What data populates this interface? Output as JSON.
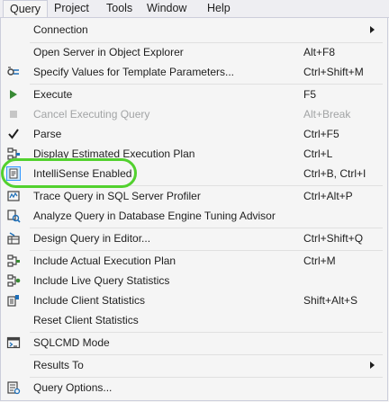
{
  "menubar": {
    "items": [
      {
        "label": "Query"
      },
      {
        "label": "Project"
      },
      {
        "label": "Tools"
      },
      {
        "label": "Window"
      },
      {
        "label": "Help"
      }
    ]
  },
  "menu": {
    "items": [
      {
        "label": "Connection",
        "shortcut": "",
        "icon": "none",
        "submenu": true
      },
      {
        "label": "Open Server in Object Explorer",
        "shortcut": "Alt+F8",
        "icon": "none"
      },
      {
        "label": "Specify Values for Template Parameters...",
        "shortcut": "Ctrl+Shift+M",
        "icon": "template-parameters-icon"
      },
      {
        "label": "Execute",
        "shortcut": "F5",
        "icon": "play-icon"
      },
      {
        "label": "Cancel Executing Query",
        "shortcut": "Alt+Break",
        "icon": "stop-icon",
        "disabled": true
      },
      {
        "label": "Parse",
        "shortcut": "Ctrl+F5",
        "icon": "checkmark-icon"
      },
      {
        "label": "Display Estimated Execution Plan",
        "shortcut": "Ctrl+L",
        "icon": "estimated-plan-icon"
      },
      {
        "label": "IntelliSense Enabled",
        "shortcut": "Ctrl+B, Ctrl+I",
        "icon": "intellisense-icon",
        "checked": true
      },
      {
        "label": "Trace Query in SQL Server Profiler",
        "shortcut": "Ctrl+Alt+P",
        "icon": "profiler-icon"
      },
      {
        "label": "Analyze Query in Database Engine Tuning Advisor",
        "shortcut": "",
        "icon": "tuning-advisor-icon"
      },
      {
        "label": "Design Query in Editor...",
        "shortcut": "Ctrl+Shift+Q",
        "icon": "design-query-icon"
      },
      {
        "label": "Include Actual Execution Plan",
        "shortcut": "Ctrl+M",
        "icon": "actual-plan-icon"
      },
      {
        "label": "Include Live Query Statistics",
        "shortcut": "",
        "icon": "live-stats-icon"
      },
      {
        "label": "Include Client Statistics",
        "shortcut": "Shift+Alt+S",
        "icon": "client-stats-icon"
      },
      {
        "label": "Reset Client Statistics",
        "shortcut": "",
        "icon": "none"
      },
      {
        "label": "SQLCMD Mode",
        "shortcut": "",
        "icon": "sqlcmd-icon"
      },
      {
        "label": "Results To",
        "shortcut": "",
        "icon": "none",
        "submenu": true
      },
      {
        "label": "Query Options...",
        "shortcut": "",
        "icon": "query-options-icon"
      }
    ]
  },
  "colors": {
    "highlight_ring": "#52d12e",
    "play_green": "#388a34",
    "menu_background": "#f5f5f5"
  }
}
